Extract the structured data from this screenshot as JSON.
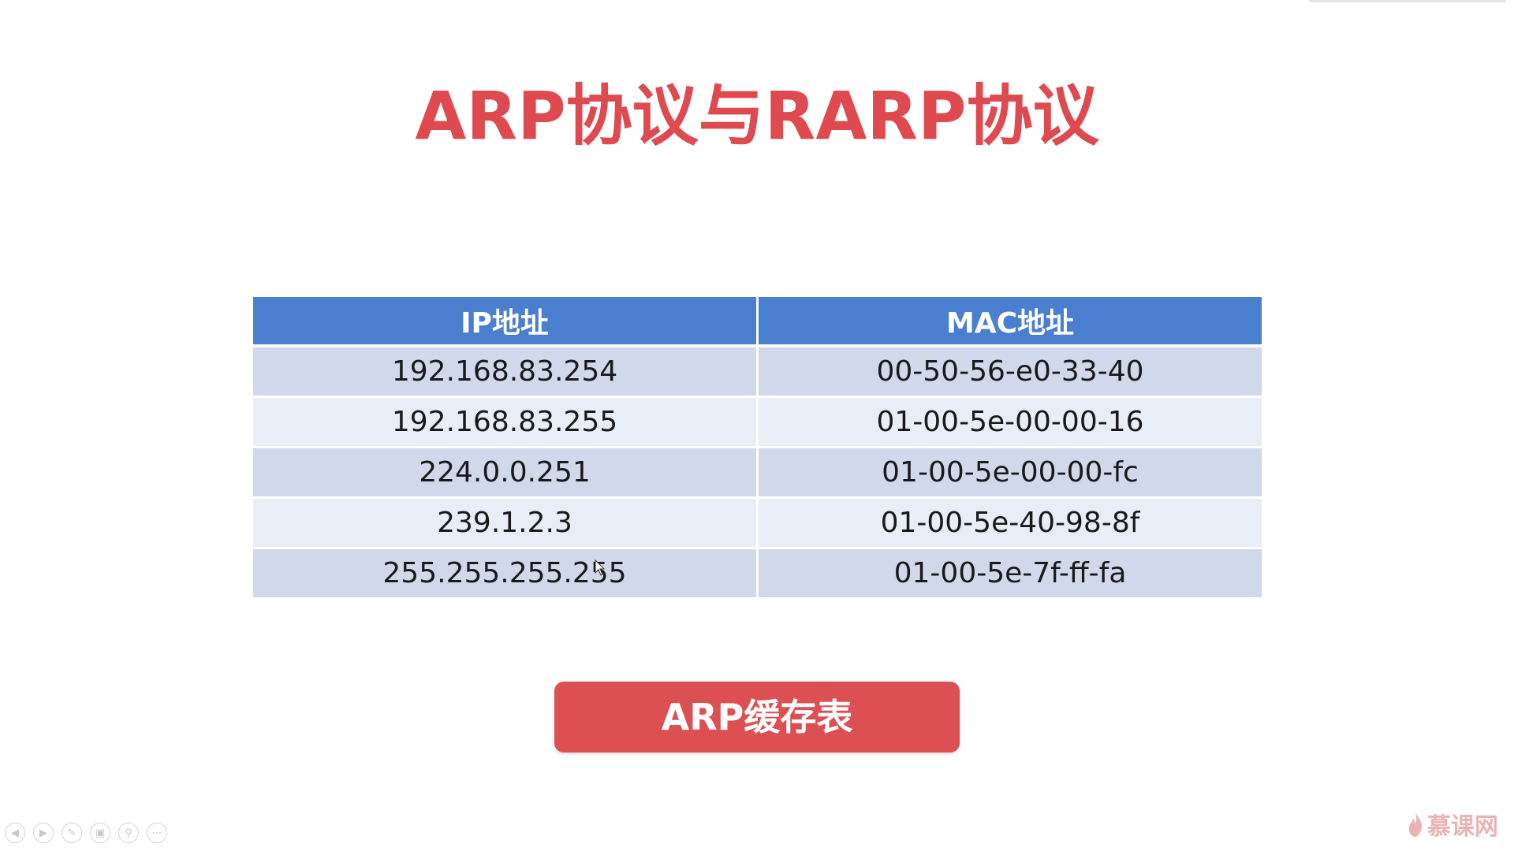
{
  "slide": {
    "title": "ARP协议与RARP协议",
    "title_color": "#de4a4f"
  },
  "table": {
    "header_color": "#4a7fd0",
    "headers": [
      "IP地址",
      "MAC地址"
    ],
    "rows": [
      {
        "ip": "192.168.83.254",
        "mac": "00-50-56-e0-33-40"
      },
      {
        "ip": "192.168.83.255",
        "mac": "01-00-5e-00-00-16"
      },
      {
        "ip": "224.0.0.251",
        "mac": "01-00-5e-00-00-fc"
      },
      {
        "ip": "239.1.2.3",
        "mac": "01-00-5e-40-98-8f"
      },
      {
        "ip": "255.255.255.255",
        "mac": "01-00-5e-7f-ff-fa"
      }
    ]
  },
  "button": {
    "label": "ARP缓存表",
    "color": "#dc4f52"
  },
  "player_controls": [
    "prev-icon",
    "next-icon",
    "pen-icon",
    "slides-icon",
    "zoom-icon",
    "more-icon"
  ],
  "watermark": {
    "text": "慕课网",
    "icon": "flame-icon"
  }
}
